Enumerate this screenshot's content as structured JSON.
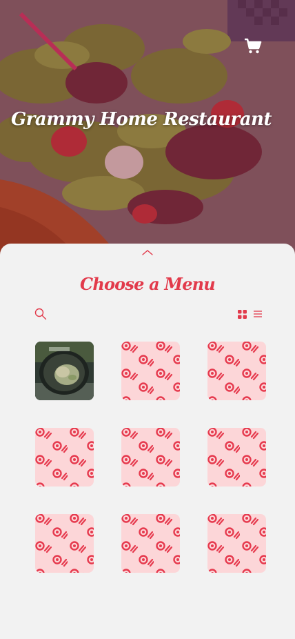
{
  "hero": {
    "title": "Grammy Home Restaurant",
    "cart_icon": "shopping-cart-icon"
  },
  "menu": {
    "heading": "Choose a Menu",
    "collapse_icon": "chevron-up-icon",
    "search_icon": "search-icon",
    "view_toggle": {
      "grid_icon": "grid-view-icon",
      "list_icon": "list-view-icon",
      "active": "grid"
    },
    "items": [
      {
        "type": "photo",
        "image": "pan-dish-photo"
      },
      {
        "type": "placeholder"
      },
      {
        "type": "placeholder"
      },
      {
        "type": "placeholder"
      },
      {
        "type": "placeholder"
      },
      {
        "type": "placeholder"
      },
      {
        "type": "placeholder"
      },
      {
        "type": "placeholder"
      },
      {
        "type": "placeholder"
      }
    ]
  },
  "colors": {
    "accent": "#e23a4b",
    "placeholder_bg": "#fcd6d8",
    "sheet_bg": "#f2f2f2"
  }
}
